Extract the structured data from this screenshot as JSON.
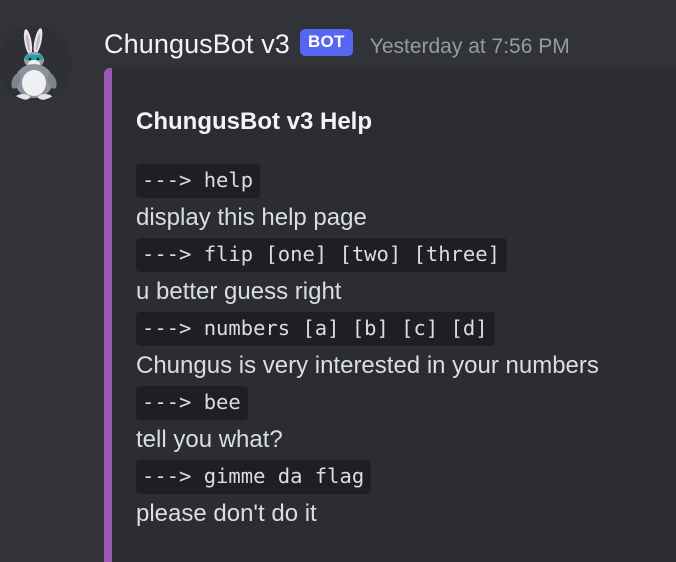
{
  "message": {
    "username": "ChungusBot v3",
    "bot_tag": "BOT",
    "timestamp": "Yesterday at 7:56 PM",
    "avatar_icon": "big-chungus-avatar-icon"
  },
  "embed": {
    "accent_color": "#9b59b6",
    "title": "ChungusBot v3 Help",
    "commands": [
      {
        "command": "---> help",
        "description": "display this help page"
      },
      {
        "command": "---> flip [one] [two] [three]",
        "description": "u better guess right"
      },
      {
        "command": "---> numbers [a] [b] [c] [d]",
        "description": "Chungus is very interested in your numbers"
      },
      {
        "command": "---> bee",
        "description": "tell you what?"
      },
      {
        "command": "---> gimme da flag",
        "description": "please don't do it"
      }
    ]
  },
  "colors": {
    "background": "#323338",
    "embed_background": "#2b2d31",
    "bot_tag": "#5865f2",
    "code_background": "#1e1f22"
  }
}
